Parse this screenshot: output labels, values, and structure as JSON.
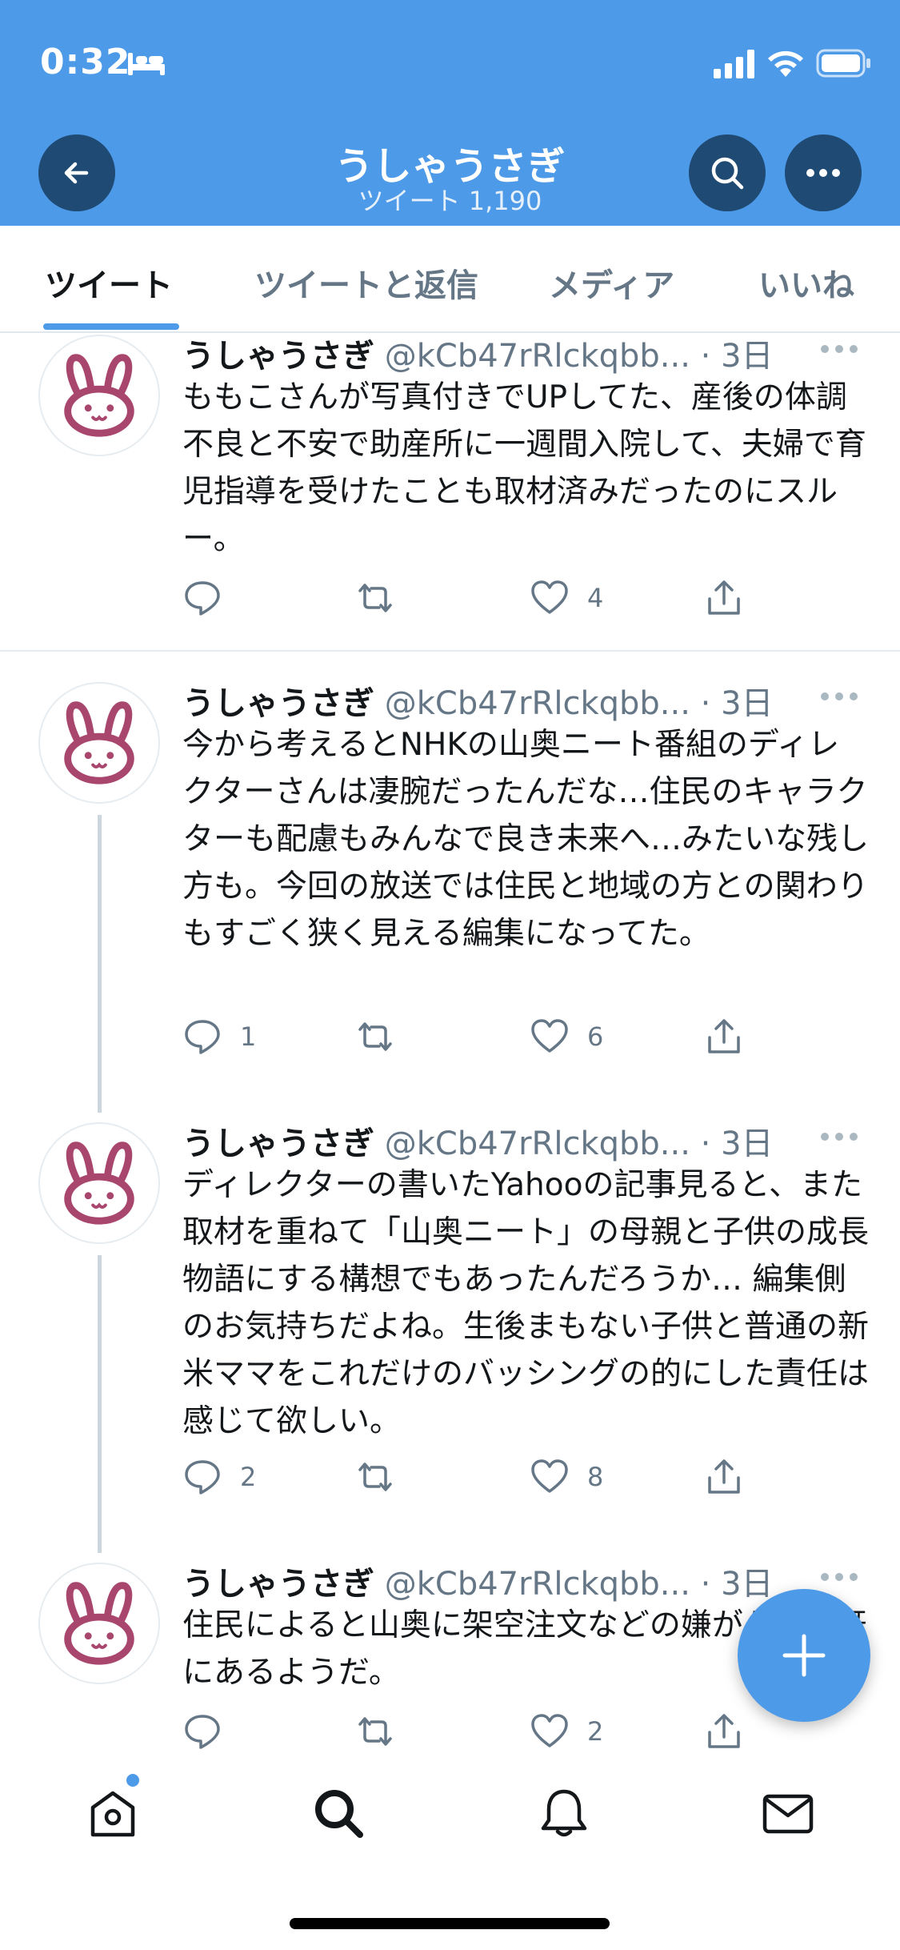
{
  "status_bar": {
    "time": "0:32"
  },
  "header": {
    "title": "うしゃうさぎ",
    "subtitle": "ツイート 1,190"
  },
  "tabs": [
    {
      "label": "ツイート",
      "active": true
    },
    {
      "label": "ツイートと返信",
      "active": false
    },
    {
      "label": "メディア",
      "active": false
    },
    {
      "label": "いいね",
      "active": false
    }
  ],
  "tweets": [
    {
      "name": "うしゃうさぎ",
      "handle": "@kCb47rRlckqbb...",
      "time": "· 3日",
      "text": "ももこさんが写真付きでUPしてた、産後の体調不良と不安で助産所に一週間入院して、夫婦で育児指導を受けたことも取材済みだったのにスルー。",
      "replies": "",
      "retweets": "",
      "likes": "4"
    },
    {
      "name": "うしゃうさぎ",
      "handle": "@kCb47rRlckqbb...",
      "time": "· 3日",
      "text": "今から考えるとNHKの山奥ニート番組のディレクターさんは凄腕だったんだな…住民のキャラクターも配慮もみんなで良き未来へ…みたいな残し方も。今回の放送では住民と地域の方との関わりもすごく狭く見える編集になってた。",
      "replies": "1",
      "retweets": "",
      "likes": "6"
    },
    {
      "name": "うしゃうさぎ",
      "handle": "@kCb47rRlckqbb...",
      "time": "· 3日",
      "text": "ディレクターの書いたYahooの記事見ると、また取材を重ねて「山奥ニート」の母親と子供の成長物語にする構想でもあったんだろうか… 編集側のお気持ちだよね。生後まもない子供と普通の新米ママをこれだけのバッシングの的にした責任は感じて欲しい。",
      "replies": "2",
      "retweets": "",
      "likes": "8"
    },
    {
      "name": "うしゃうさぎ",
      "handle": "@kCb47rRlckqbb...",
      "time": "· 3日",
      "text": "住民によると山奥に架空注文などの嫌がらせも既にあるようだ。",
      "replies": "",
      "retweets": "",
      "likes": "2"
    }
  ],
  "icons": {
    "back": "arrow-left-icon",
    "search": "search-icon",
    "more": "more-icon",
    "compose": "plus-icon",
    "nav": [
      "home-icon",
      "search-icon",
      "bell-icon",
      "mail-icon"
    ]
  },
  "colors": {
    "header_bg": "#4d9ae8",
    "accent": "#4d9ae8",
    "avatar_bunny": "#a8466e"
  }
}
